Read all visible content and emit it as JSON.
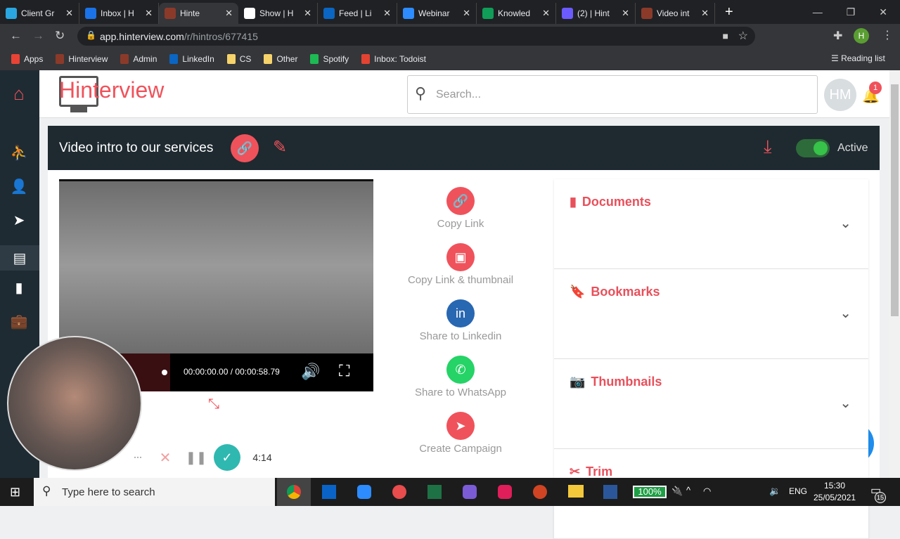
{
  "browser": {
    "tabs": [
      {
        "title": "Client Gr",
        "color": "#2aa6e0"
      },
      {
        "title": "Inbox | H",
        "color": "#1a73e8"
      },
      {
        "title": "Hinte",
        "color": "#8b3a2a",
        "active": true
      },
      {
        "title": "Show | H",
        "color": "#ffffff"
      },
      {
        "title": "Feed | Li",
        "color": "#0a66c2"
      },
      {
        "title": "Webinar",
        "color": "#2d8cff"
      },
      {
        "title": "Knowled",
        "color": "#0f9d58"
      },
      {
        "title": "(2) | Hint",
        "color": "#6b5bff"
      },
      {
        "title": "Video int",
        "color": "#8b3a2a"
      }
    ],
    "new_tab": "+",
    "url_host": "app.hinterview.com",
    "url_path": "/r/hintros/677415",
    "profile_initial": "H",
    "bookmarks": [
      {
        "label": "Apps",
        "color": "#ea4335"
      },
      {
        "label": "Hinterview",
        "color": "#8b3a2a"
      },
      {
        "label": "Admin",
        "color": "#8b3a2a"
      },
      {
        "label": "LinkedIn",
        "color": "#0a66c2"
      },
      {
        "label": "CS",
        "color": "#f6d36b"
      },
      {
        "label": "Other",
        "color": "#f6d36b"
      },
      {
        "label": "Spotify",
        "color": "#1db954"
      },
      {
        "label": "Inbox: Todoist",
        "color": "#e44332"
      }
    ],
    "reading_list": "Reading list"
  },
  "app": {
    "logo": "Hinterview",
    "search_placeholder": "Search...",
    "avatar": "HM",
    "notif_count": "1",
    "accent": "#f0525b",
    "title": "Video intro to our services",
    "status": "Active",
    "video_time": "00:00:00.00 / 00:00:58.79",
    "actions": [
      {
        "label": "Copy Link",
        "icon": "link-icon",
        "color": "#f0525b",
        "glyph": "🔗"
      },
      {
        "label": "Copy Link & thumbnail",
        "icon": "image-icon",
        "color": "#f0525b",
        "glyph": "▣"
      },
      {
        "label": "Share to Linkedin",
        "icon": "linkedin-icon",
        "color": "#2867b2",
        "glyph": "in"
      },
      {
        "label": "Share to WhatsApp",
        "icon": "whatsapp-icon",
        "color": "#25d366",
        "glyph": "✆"
      },
      {
        "label": "Create Campaign",
        "icon": "send-icon",
        "color": "#f0525b",
        "glyph": "➤"
      }
    ],
    "panels": [
      {
        "label": "Documents",
        "glyph": "▮"
      },
      {
        "label": "Bookmarks",
        "glyph": "🔖"
      },
      {
        "label": "Thumbnails",
        "glyph": "📷"
      },
      {
        "label": "Trim",
        "glyph": "✂"
      }
    ],
    "recorder_time": "4:14",
    "recorder_more": "···"
  },
  "taskbar": {
    "search_placeholder": "Type here to search",
    "battery": "100%",
    "lang": "ENG",
    "time": "15:30",
    "date": "25/05/2021",
    "notifications": "15"
  }
}
